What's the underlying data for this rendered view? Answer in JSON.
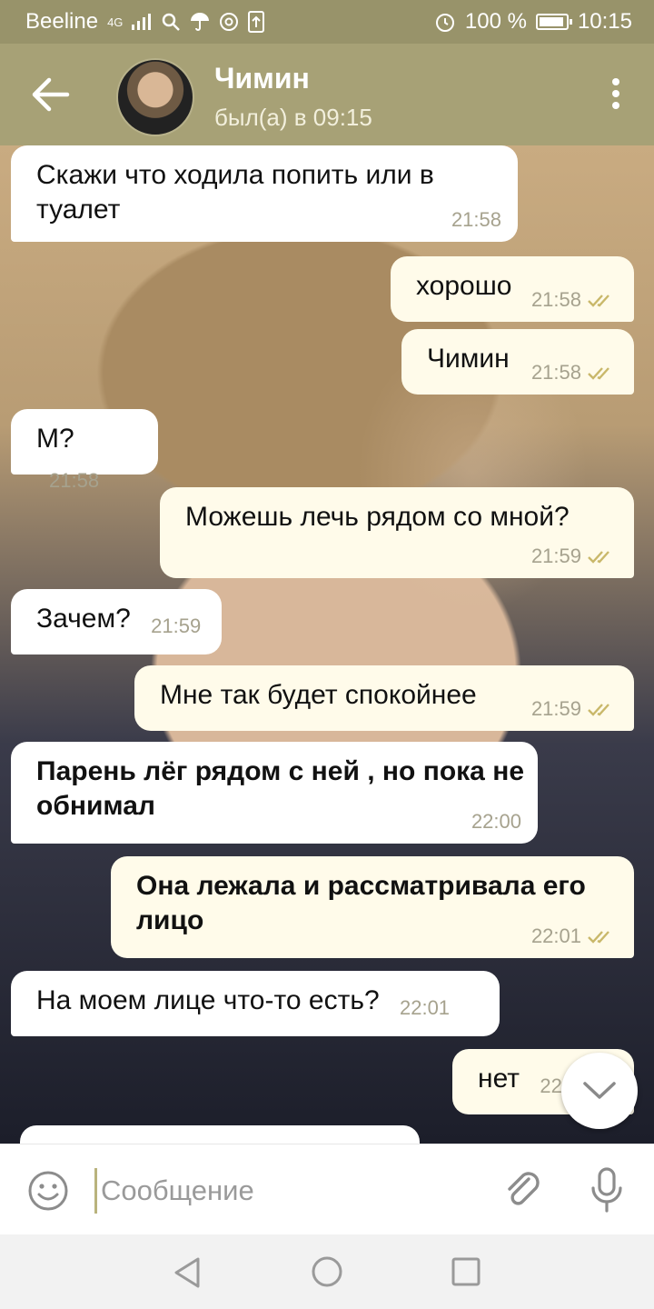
{
  "status_bar": {
    "carrier": "Beeline",
    "network": "4G",
    "battery": "100 %",
    "time": "10:15"
  },
  "header": {
    "contact_name": "Чимин",
    "last_seen": "был(а) в 09:15"
  },
  "messages": [
    {
      "dir": "in",
      "text": "Скажи что ходила попить или в туалет",
      "time": "21:58"
    },
    {
      "dir": "out",
      "text": "хорошо",
      "time": "21:58"
    },
    {
      "dir": "out",
      "text": "Чимин",
      "time": "21:58"
    },
    {
      "dir": "in",
      "text": "М?",
      "time": "21:58"
    },
    {
      "dir": "out",
      "text": "Можешь лечь рядом со мной?",
      "time": "21:59"
    },
    {
      "dir": "in",
      "text": "Зачем?",
      "time": "21:59"
    },
    {
      "dir": "out",
      "text": "Мне так будет спокойнее",
      "time": "21:59"
    },
    {
      "dir": "in",
      "text": "Парень лёг рядом с ней , но пока не обнимал",
      "time": "22:00"
    },
    {
      "dir": "out",
      "text": "Она лежала и рассматривала его лицо",
      "time": "22:01"
    },
    {
      "dir": "in",
      "text": "На моем лице что-то есть?",
      "time": "22:01"
    },
    {
      "dir": "out",
      "text": "нет",
      "time": "22:"
    }
  ],
  "composer": {
    "placeholder": "Сообщение"
  },
  "colors": {
    "header": "#a7a176",
    "status_bar": "#98936a",
    "incoming_bubble": "#ffffff",
    "outgoing_bubble": "#fffbea",
    "read_ticks": "#c9b86a"
  }
}
